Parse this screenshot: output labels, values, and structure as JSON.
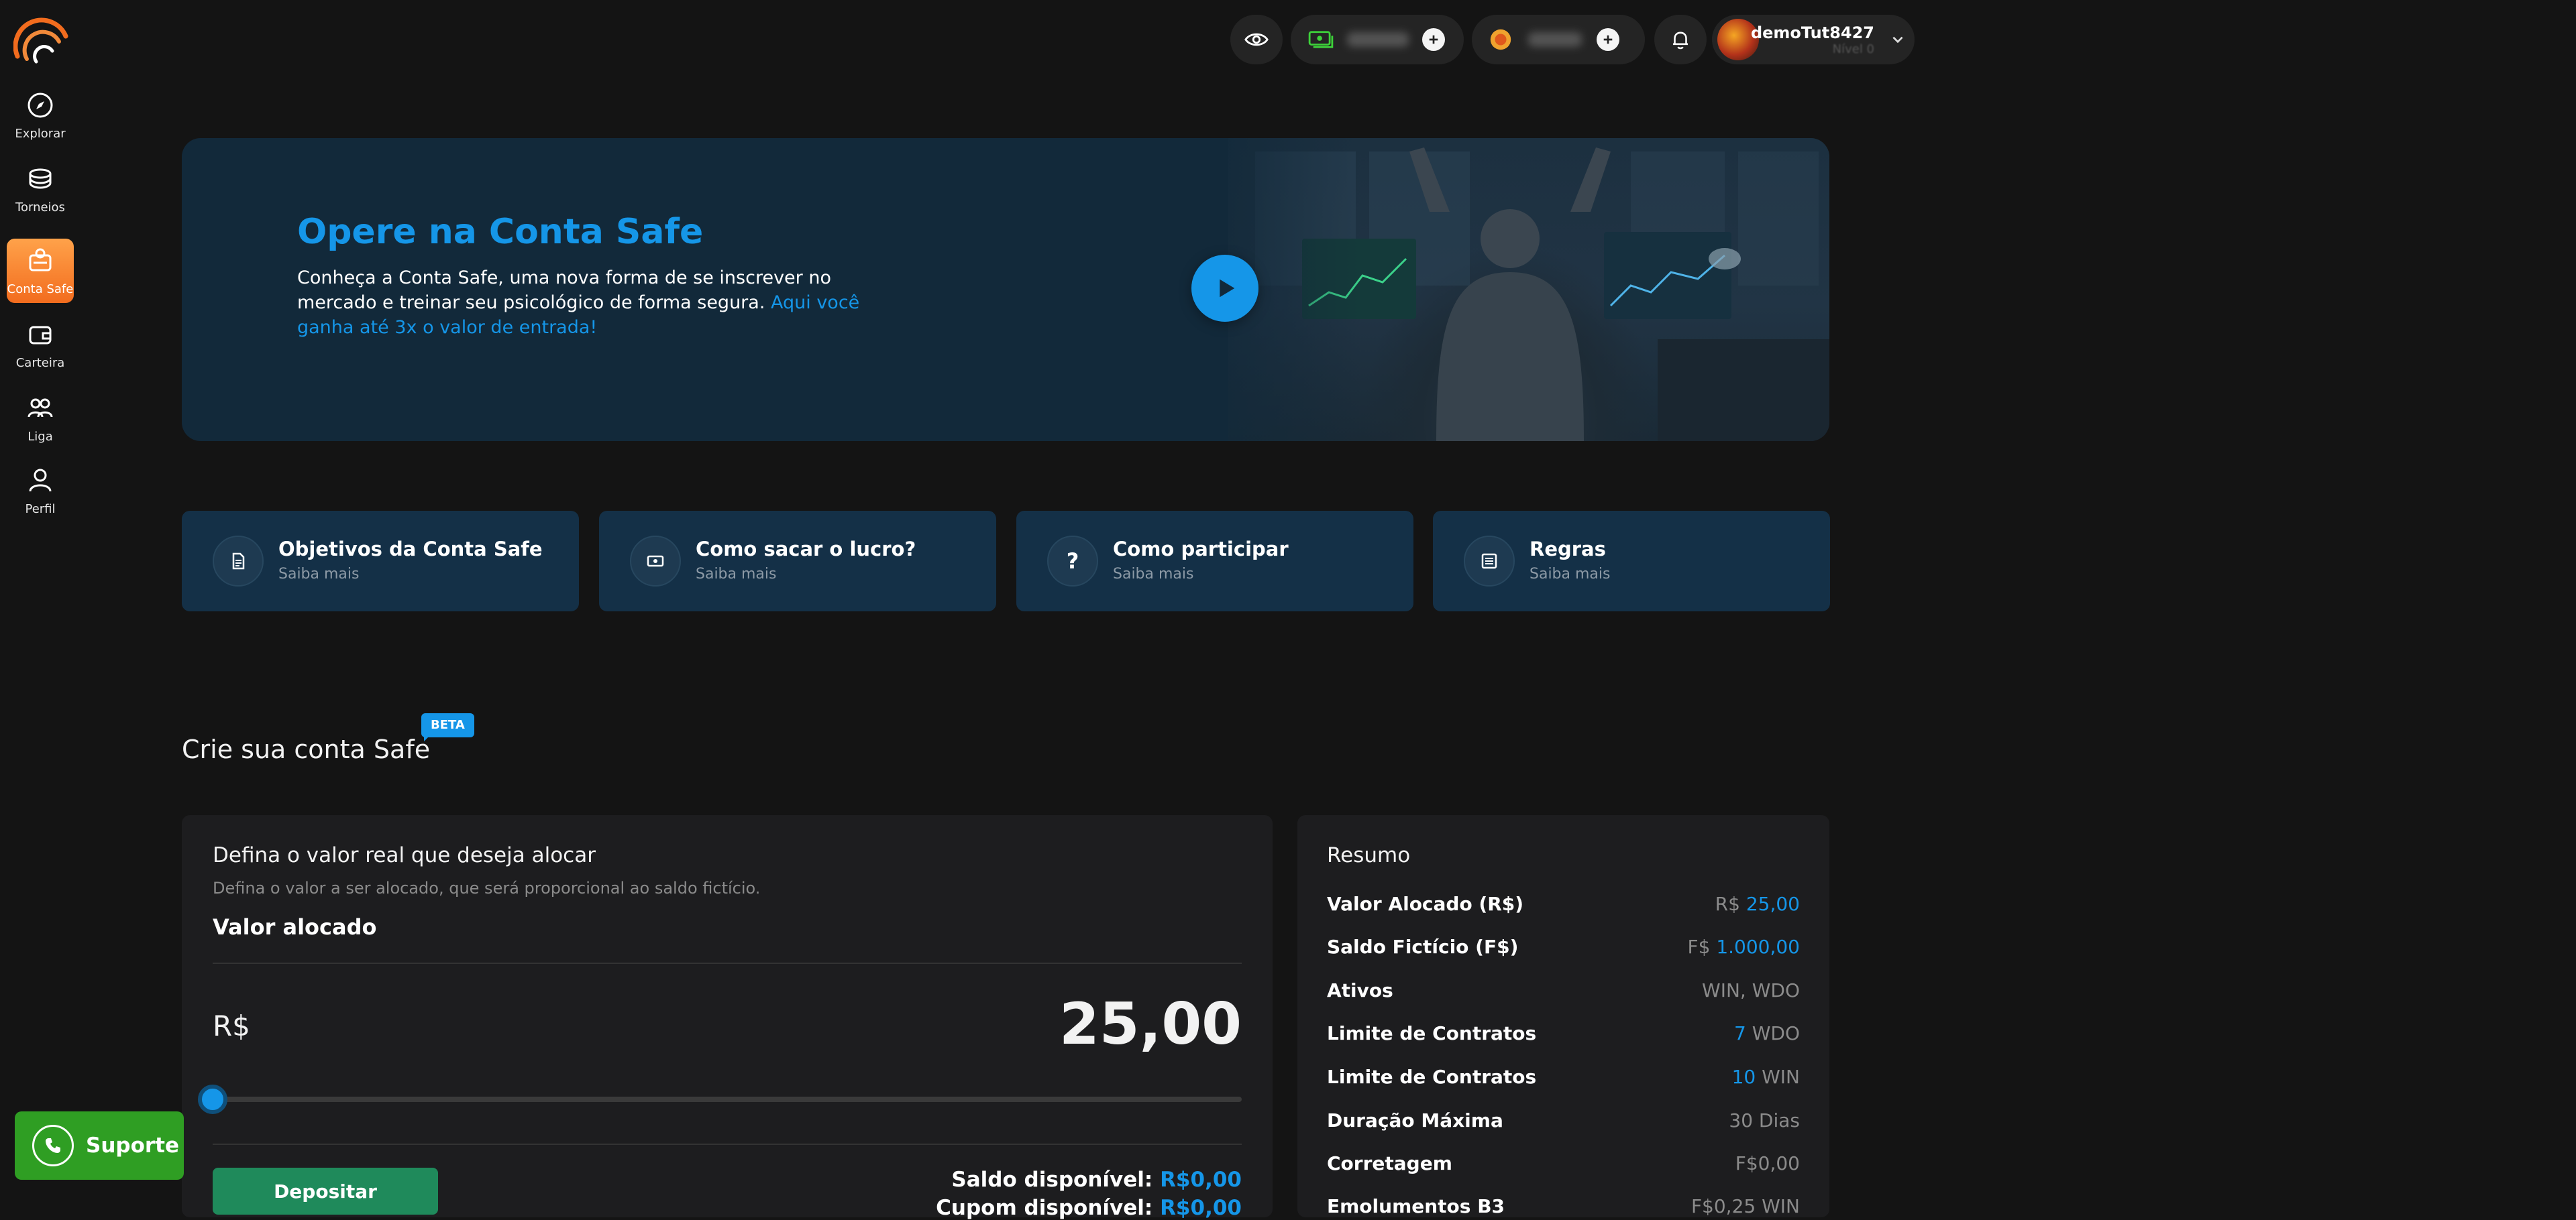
{
  "sidebar": {
    "items": [
      {
        "label": "Explorar",
        "icon": "compass-icon"
      },
      {
        "label": "Torneios",
        "icon": "tournament-icon"
      },
      {
        "label": "Conta Safe",
        "icon": "safe-account-icon",
        "active": true
      },
      {
        "label": "Carteira",
        "icon": "wallet-icon"
      },
      {
        "label": "Liga",
        "icon": "league-icon"
      },
      {
        "label": "Perfil",
        "icon": "user-icon"
      }
    ]
  },
  "topbar": {
    "user": {
      "name": "demoTut8427",
      "level": "Nível 0"
    }
  },
  "hero": {
    "title": "Opere na Conta Safe",
    "text": "Conheça a Conta Safe, uma nova forma de se inscrever no mercado e treinar seu psicológico de forma segura. ",
    "highlight": "Aqui você ganha até 3x o valor de entrada!"
  },
  "info_cards": [
    {
      "title": "Objetivos da Conta Safe",
      "sub": "Saiba mais",
      "icon": "document-icon"
    },
    {
      "title": "Como sacar o lucro?",
      "sub": "Saiba mais",
      "icon": "cash-icon"
    },
    {
      "title": "Como participar",
      "sub": "Saiba mais",
      "icon": "question-icon"
    },
    {
      "title": "Regras",
      "sub": "Saiba mais",
      "icon": "list-icon"
    }
  ],
  "section": {
    "title": "Crie sua conta Safe",
    "badge": "BETA"
  },
  "allocation": {
    "title": "Defina o valor real que deseja alocar",
    "desc": "Defina o valor a ser alocado, que será proporcional ao saldo fictício.",
    "label": "Valor alocado",
    "currency": "R$",
    "value": "25,00",
    "slider_fraction": 0,
    "deposit_label": "Depositar",
    "balance_label": "Saldo disponível: ",
    "balance_value": "R$0,00",
    "coupon_label": "Cupom disponível: ",
    "coupon_value": "R$0,00"
  },
  "summary": {
    "title": "Resumo",
    "rows": [
      {
        "key": "Valor Alocado (R$)",
        "prefix": "R$ ",
        "bold": "25,00",
        "suffix": ""
      },
      {
        "key": "Saldo Fictício (F$)",
        "prefix": "F$ ",
        "bold": "1.000,00",
        "suffix": ""
      },
      {
        "key": "Ativos",
        "prefix": "WIN, WDO",
        "bold": "",
        "suffix": ""
      },
      {
        "key": "Limite de Contratos",
        "prefix": "",
        "bold": "7",
        "suffix": " WDO"
      },
      {
        "key": "Limite de Contratos",
        "prefix": "",
        "bold": "10",
        "suffix": " WIN"
      },
      {
        "key": "Duração Máxima",
        "prefix": "30 Dias",
        "bold": "",
        "suffix": ""
      },
      {
        "key": "Corretagem",
        "prefix": "F$0,00",
        "bold": "",
        "suffix": ""
      },
      {
        "key": "Emolumentos B3",
        "prefix": "F$0,25 WIN",
        "bold": "",
        "suffix": ""
      }
    ]
  },
  "support": {
    "label": "Suporte"
  },
  "colors": {
    "accent": "#1596e8",
    "brand_orange": "#f26c1e",
    "support_green": "#2f9e23",
    "deposit_green": "#1f8a5b"
  }
}
